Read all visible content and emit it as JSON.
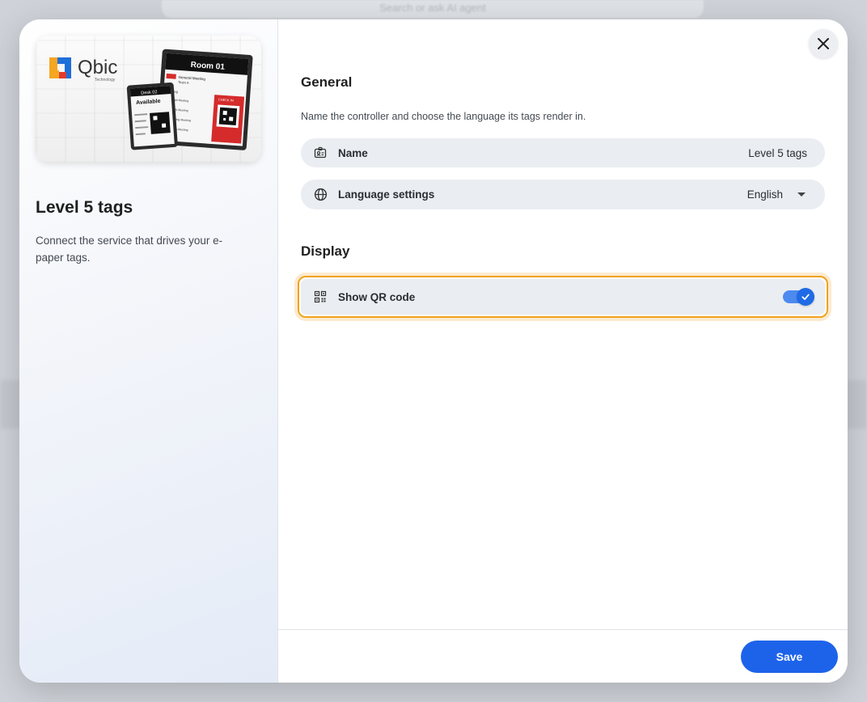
{
  "background": {
    "search_placeholder": "Search or ask AI agent"
  },
  "sidebar": {
    "hero_image": {
      "brand": "Qbic",
      "brand_sub": "Technology",
      "device_big_title": "Room 01",
      "device_big_lines": [
        "General Meeting",
        "Team A",
        "Booking",
        "Budget Meeting",
        "Weekly Meeting",
        "Marketing Meeting",
        "Updates Meeting"
      ],
      "device_big_tag": "CHECK IN",
      "device_small_title": "Desk 02",
      "device_small_status": "Available"
    },
    "title": "Level 5 tags",
    "description": "Connect the service that drives your e-paper tags."
  },
  "close_label": "×",
  "general": {
    "title": "General",
    "description": "Name the controller and choose the language its tags render in.",
    "name_row": {
      "label": "Name",
      "value": "Level 5 tags",
      "icon": "id-card-icon"
    },
    "language_row": {
      "label": "Language settings",
      "value": "English",
      "icon": "globe-icon"
    }
  },
  "display": {
    "title": "Display",
    "qr_row": {
      "label": "Show QR code",
      "enabled": true,
      "icon": "qr-code-icon"
    }
  },
  "footer": {
    "save_label": "Save"
  },
  "colors": {
    "accent": "#1d63ea",
    "highlight": "#f0a21e",
    "row_bg": "#eaedf1"
  }
}
